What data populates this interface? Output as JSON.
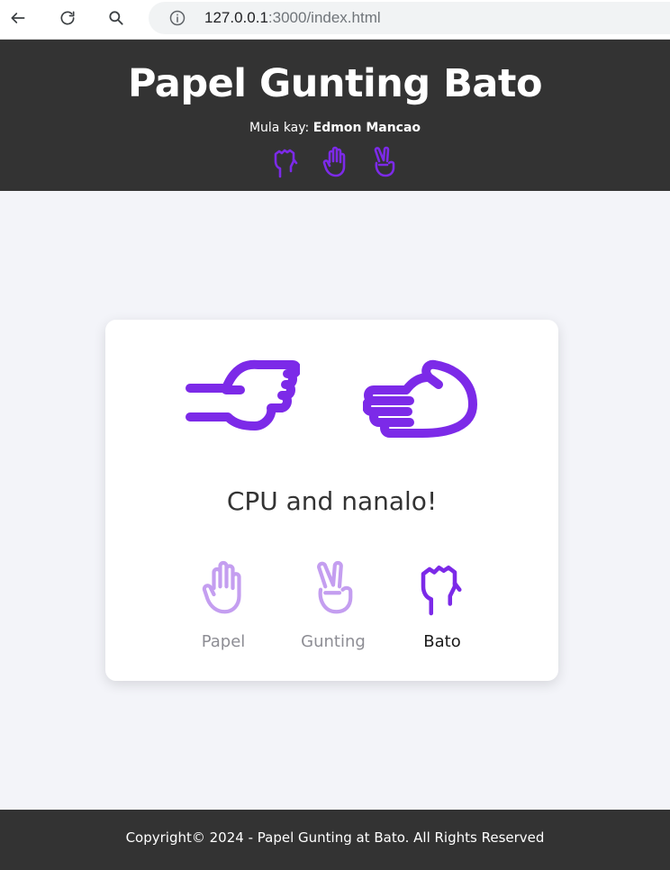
{
  "browser": {
    "url_host": "127.0.0.1",
    "url_rest": ":3000/index.html",
    "icons": [
      "back-arrow-icon",
      "reload-icon",
      "search-icon",
      "info-icon"
    ]
  },
  "header": {
    "title": "Papel Gunting Bato",
    "byline_prefix": "Mula kay: ",
    "author": "Edmon Mancao",
    "icons": [
      "fist-icon",
      "open-hand-icon",
      "peace-hand-icon"
    ]
  },
  "game": {
    "player_hand_icon": "fist-sideways-icon",
    "cpu_hand_icon": "open-hand-sideways-icon",
    "result": "CPU and nanalo!",
    "choices": [
      {
        "label": "Papel",
        "icon": "open-hand-icon",
        "selected": false
      },
      {
        "label": "Gunting",
        "icon": "peace-hand-icon",
        "selected": false
      },
      {
        "label": "Bato",
        "icon": "fist-icon",
        "selected": true
      }
    ]
  },
  "footer": {
    "copyright": "Copyright© 2024 - Papel Gunting at Bato. All Rights Reserved"
  },
  "colors": {
    "accent": "#7c2ae8",
    "accent_light": "#c49ef0",
    "header_bg": "#333333",
    "page_bg": "#f3f4f9"
  }
}
